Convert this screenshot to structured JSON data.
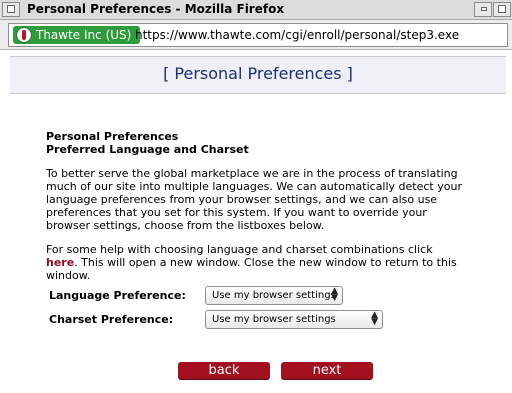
{
  "window": {
    "title": "Personal Preferences - Mozilla Firefox"
  },
  "urlbar": {
    "identity": "Thawte Inc (US)",
    "url": "https://www.thawte.com/cgi/enroll/personal/step3.exe"
  },
  "page": {
    "header": "[ Personal Preferences ]",
    "section_title_1": "Personal Preferences",
    "section_title_2": "Preferred Language and Charset",
    "intro": "To better serve the global marketplace we are in the process of translating much of our site into multiple languages. We can automatically detect your language preferences from your browser settings, and we can also use preferences that you set for this system. If you want to override your browser settings, choose from the listboxes below.",
    "help_before": "For some help with choosing language and charset combinations click ",
    "help_link": "here",
    "help_after": ". This will open a new window. Close the new window to return to this window."
  },
  "form": {
    "language_label": "Language Preference:",
    "language_value": "Use my browser settings",
    "charset_label": "Charset Preference:",
    "charset_value": "Use my browser settings"
  },
  "buttons": {
    "back": "back",
    "next": "next"
  },
  "icons": {
    "identity": "identity-lock-icon",
    "dropdown": "updown-arrows-icon"
  },
  "colors": {
    "header_text": "#1c2f6e",
    "button": "#a3101f",
    "identity": "#2f9c3c",
    "link": "#8b1026"
  }
}
